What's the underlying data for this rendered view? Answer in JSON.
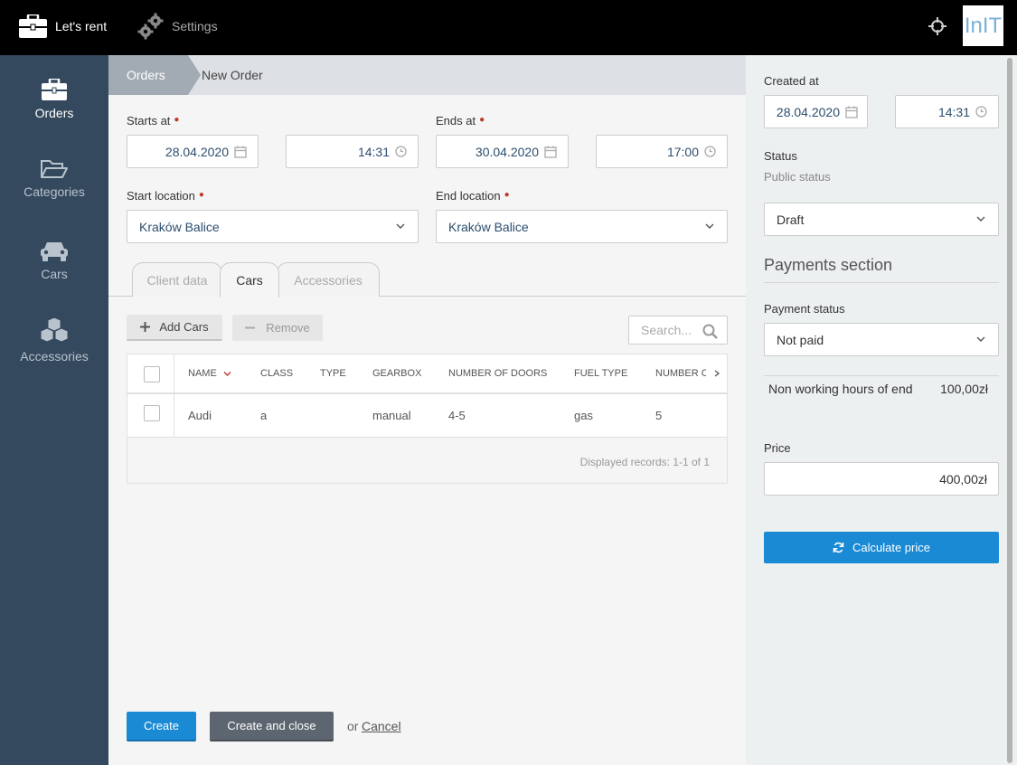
{
  "topbar": {
    "app_name": "Let's rent",
    "settings_label": "Settings",
    "logo_text": "InIT"
  },
  "sidebar": {
    "items": [
      {
        "label": "Orders",
        "icon": "briefcase-icon",
        "active": true
      },
      {
        "label": "Categories",
        "icon": "folder-open-icon",
        "active": false
      },
      {
        "label": "Cars",
        "icon": "car-icon",
        "active": false
      },
      {
        "label": "Accessories",
        "icon": "cubes-icon",
        "active": false
      }
    ]
  },
  "breadcrumb": {
    "parent": "Orders",
    "current": "New Order"
  },
  "form": {
    "starts_at": {
      "label": "Starts at",
      "date": "28.04.2020",
      "time": "14:31"
    },
    "ends_at": {
      "label": "Ends at",
      "date": "30.04.2020",
      "time": "17:00"
    },
    "start_location": {
      "label": "Start location",
      "value": "Kraków Balice"
    },
    "end_location": {
      "label": "End location",
      "value": "Kraków Balice"
    }
  },
  "tabs": [
    {
      "label": "Client data",
      "active": false
    },
    {
      "label": "Cars",
      "active": true
    },
    {
      "label": "Accessories",
      "active": false
    }
  ],
  "toolbar": {
    "add_label": "Add Cars",
    "remove_label": "Remove",
    "search_placeholder": "Search..."
  },
  "grid": {
    "columns": [
      "NAME",
      "CLASS",
      "TYPE",
      "GEARBOX",
      "NUMBER OF DOORS",
      "FUEL TYPE",
      "NUMBER O"
    ],
    "rows": [
      {
        "name": "Audi",
        "class": "a",
        "type": "",
        "gearbox": "manual",
        "doors": "4-5",
        "fuel": "gas",
        "number": "5"
      }
    ],
    "footer": "Displayed records: 1-1 of 1"
  },
  "actions": {
    "create": "Create",
    "create_close": "Create and close",
    "or": "or",
    "cancel": "Cancel"
  },
  "panel": {
    "created_at_label": "Created at",
    "created_date": "28.04.2020",
    "created_time": "14:31",
    "status_label": "Status",
    "public_status_label": "Public status",
    "status_value": "Draft",
    "payments_title": "Payments section",
    "payment_status_label": "Payment status",
    "payment_status_value": "Not paid",
    "fee_label": "Non working hours of end",
    "fee_value": "100,00zł",
    "price_label": "Price",
    "price_value": "400,00zł",
    "calc_label": "Calculate price"
  },
  "colors": {
    "topbar": "#000000",
    "sidebar": "#34495e",
    "primary": "#1a8ad4",
    "dark_button": "#5d6670",
    "required": "#c0392b"
  }
}
